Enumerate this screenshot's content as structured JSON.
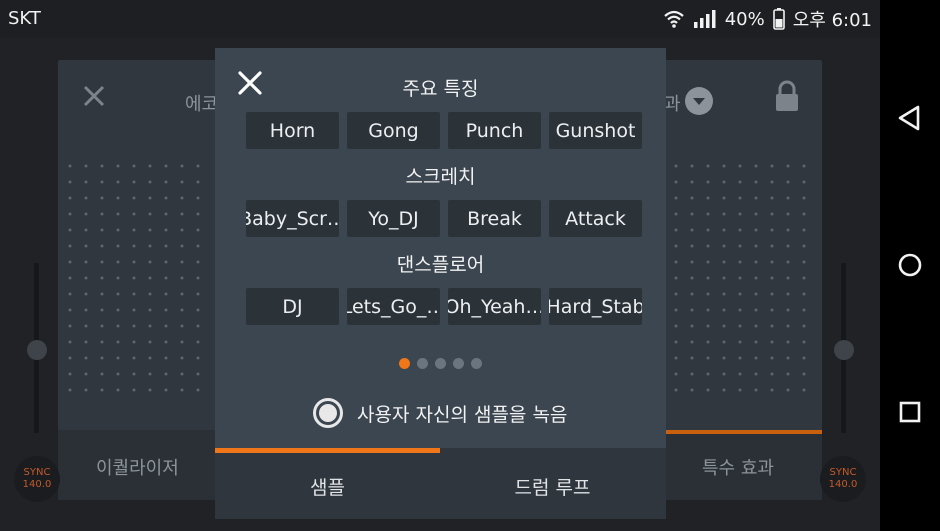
{
  "status_bar": {
    "carrier": "SKT",
    "battery": "40%",
    "time": "오후 6:01",
    "icons": [
      "wifi-icon",
      "signal-icon",
      "battery-icon"
    ]
  },
  "background": {
    "left_label": "에코",
    "right_label": "과",
    "left_tab": "이퀄라이저",
    "right_tab": "특수 효과",
    "sync_label": "SYNC",
    "bpm_left": "140.0",
    "bpm_right": "140.0"
  },
  "modal": {
    "sections": [
      {
        "title": "주요 특징",
        "buttons": [
          "Horn",
          "Gong",
          "Punch",
          "Gunshot"
        ]
      },
      {
        "title": "스크레치",
        "buttons": [
          "Baby_Scr…",
          "Yo_DJ",
          "Break",
          "Attack"
        ]
      },
      {
        "title": "댄스플로어",
        "buttons": [
          "DJ",
          "Lets_Go_…",
          "Oh_Yeah…",
          "Hard_Stab"
        ]
      }
    ],
    "page_indicator": {
      "pages": 5,
      "active": 1
    },
    "record_label": "사용자 자신의 샘플을 녹음",
    "tabs": [
      {
        "label": "샘플",
        "active": true
      },
      {
        "label": "드럼 루프",
        "active": false
      }
    ]
  },
  "colors": {
    "accent": "#f0761a",
    "modal_bg": "#3c4650",
    "button_bg": "#2b3238"
  }
}
